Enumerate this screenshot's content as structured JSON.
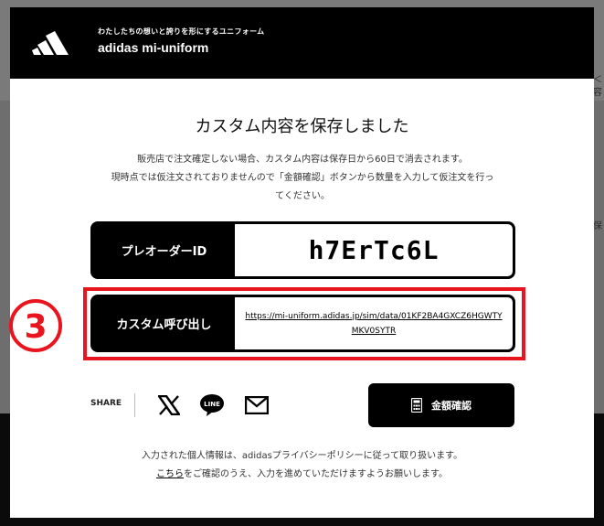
{
  "background": {
    "right_text_1": "＜",
    "right_text_2": "容",
    "right_text_3": "保"
  },
  "header": {
    "tagline": "わたしたちの想いと誇りを形にするユニフォーム",
    "brand": "adidas mi-uniform",
    "logo_icon": "adidas-logo-icon"
  },
  "main": {
    "title": "カスタム内容を保存しました",
    "desc_line1": "販売店で注文確定しない場合、カスタム内容は保存日から60日で消去されます。",
    "desc_line2": "現時点では仮注文されておりませんので「金額確認」ボタンから数量を入力して仮注文を行っ",
    "desc_line3": "てください。"
  },
  "preorder": {
    "label": "プレオーダーID",
    "value": "h7ErTc6L"
  },
  "custom_call": {
    "label": "カスタム呼び出し",
    "url": "https://mi-uniform.adidas.jp/sim/data/01KF2BA4GXCZ6HGWTYMKV0SYTR"
  },
  "annotation": {
    "step": "3",
    "color": "#e8141e"
  },
  "share": {
    "label": "SHARE",
    "icons": [
      "x-icon",
      "line-icon",
      "mail-icon"
    ],
    "line_text": "LINE"
  },
  "price_button": {
    "label": "金額確認",
    "icon": "calculator-icon"
  },
  "privacy": {
    "line1": "入力された個人情報は、adidasプライバシーポリシーに従って取り扱います。",
    "link": "こちら",
    "line2_rest": "をご確認のうえ、入力を進めていただけますようお願いします。"
  }
}
